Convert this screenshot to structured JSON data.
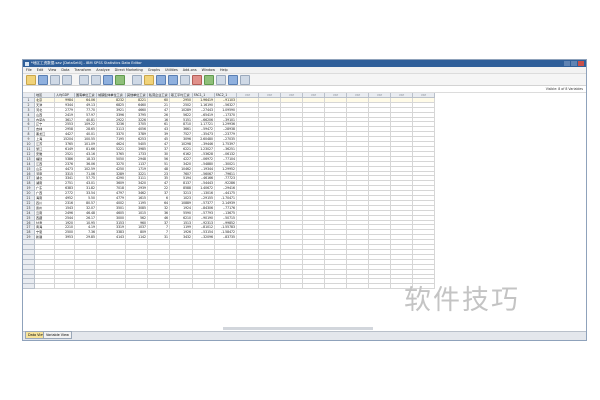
{
  "window": {
    "title": "*地区工资数据.sav [DataSet0] - IBM SPSS Statistics Data Editor",
    "menus": [
      "File",
      "Edit",
      "View",
      "Data",
      "Transform",
      "Analyze",
      "Direct Marketing",
      "Graphs",
      "Utilities",
      "Add-ons",
      "Window",
      "Help"
    ]
  },
  "status": {
    "visible_text": "Visible: 8 of 8 Variables"
  },
  "columns": [
    "地区",
    "人均GDP",
    "国有单位工资",
    "城镇集体单位工资",
    "其他单位工资",
    "私营企业工资",
    "职工平均工资",
    "FAC1_1",
    "FAC2_1",
    "var",
    "var",
    "var",
    "var",
    "var",
    "var",
    "var",
    "var",
    "var"
  ],
  "rows": [
    [
      "北京",
      "9984",
      "64.06",
      "8232",
      "8221",
      "60",
      "2950",
      "1.96419",
      "-.91103"
    ],
    [
      "天津",
      "9344",
      "49.13",
      "6825",
      "6460",
      "21",
      "2502",
      "1.16190",
      "-.56327"
    ],
    [
      "河北",
      "2779",
      "77.70",
      "3921",
      "4660",
      "47",
      "10289",
      "-.27443",
      "1.09590"
    ],
    [
      "山西",
      "2419",
      "57.97",
      "3396",
      "3795",
      "26",
      "5622",
      "-.65419",
      "-.17370"
    ],
    [
      "内蒙古",
      "3617",
      "40.81",
      "2922",
      "3226",
      "16",
      "5151",
      "-.66206",
      "-.39101"
    ],
    [
      "辽宁",
      "2553",
      "109.22",
      "3236",
      "3705",
      "61",
      "8710",
      "1.17721",
      "1.29936"
    ],
    [
      "吉林",
      "2958",
      "28.65",
      "3113",
      "4056",
      "43",
      "3661",
      "-.59472",
      "-.28938"
    ],
    [
      "黑龙江",
      "4427",
      "40.01",
      "3370",
      "3789",
      "39",
      "7527",
      "-.35473",
      "-.23779"
    ],
    [
      "上海",
      "15204",
      "100.55",
      "7195",
      "6253",
      "45",
      "3096",
      "2.60480",
      "-.27035"
    ],
    [
      "江苏",
      "3765",
      "101.09",
      "4624",
      "5405",
      "47",
      "10298",
      "-.39446",
      "1.75397"
    ],
    [
      "浙江",
      "6149",
      "81.66",
      "5221",
      "3985",
      "37",
      "6221",
      "1.23027",
      "-.36251"
    ],
    [
      "安徽",
      "2521",
      "43.16",
      "3765",
      "1733",
      "30",
      "6162",
      "-.53628",
      "-.06132"
    ],
    [
      "福建",
      "5386",
      "18.33",
      "5050",
      "2948",
      "56",
      "4227",
      "-.06972",
      "-.77104"
    ],
    [
      "江西",
      "2376",
      "36.06",
      "3270",
      "1137",
      "51",
      "3420",
      "-.54880",
      "-.30021"
    ],
    [
      "山东",
      "4473",
      "102.59",
      "4250",
      "1719",
      "48",
      "10462",
      "-.19344",
      "1.29952"
    ],
    [
      "河南",
      "3315",
      "71.06",
      "3289",
      "3221",
      "23",
      "7607",
      "-.56067",
      ".79611"
    ],
    [
      "湖北",
      "3341",
      "57.75",
      "4290",
      "3111",
      "35",
      "5194",
      "-.46166",
      ".77723"
    ],
    [
      "湖南",
      "2751",
      "43.01",
      "3609",
      "3420",
      "47",
      "8137",
      "-.54443",
      ".92286"
    ],
    [
      "广东",
      "6383",
      "31.82",
      "7018",
      "2939",
      "22",
      "8588",
      "1.40672",
      "-.29416"
    ],
    [
      "广西",
      "2772",
      "33.54",
      "4797",
      "3462",
      "37",
      "3213",
      "-.13016",
      "-.44175"
    ],
    [
      "海南",
      "4952",
      "5.50",
      "4779",
      "1615",
      "6",
      "1023",
      "-.29155",
      "-1.70471"
    ],
    [
      "四川",
      "2316",
      "80.57",
      "4002",
      "1195",
      "64",
      "10889",
      "-.57377",
      "2.14939"
    ],
    [
      "贵州",
      "1543",
      "32.07",
      "3501",
      "3085",
      "32",
      "1924",
      "-.84306",
      "-.77176"
    ],
    [
      "云南",
      "2496",
      "46.48",
      "4605",
      "1015",
      "36",
      "5590",
      "-.57793",
      "-.13675"
    ],
    [
      "西藏",
      "2544",
      "26.17",
      "3000",
      "562",
      "46",
      "6210",
      "-.90190",
      "-.50715"
    ],
    [
      "甘肃",
      "1920",
      "10.95",
      "3153",
      "960",
      "37",
      "1513",
      "-.92313",
      "-.99852"
    ],
    [
      "青海",
      "2210",
      "4.19",
      "3319",
      "1037",
      "7",
      "1199",
      "-.81012",
      "-1.55783"
    ],
    [
      "宁夏",
      "2500",
      "7.36",
      "3383",
      "809",
      "7",
      "1926",
      "-.53154",
      "-1.58472"
    ],
    [
      "新疆",
      "3953",
      "29.85",
      "4143",
      "1142",
      "31",
      "3432",
      "-.32096",
      "-.83735"
    ]
  ],
  "tabs": {
    "data_view": "Data View",
    "variable_view": "Variable View"
  },
  "watermark": "软件技巧"
}
